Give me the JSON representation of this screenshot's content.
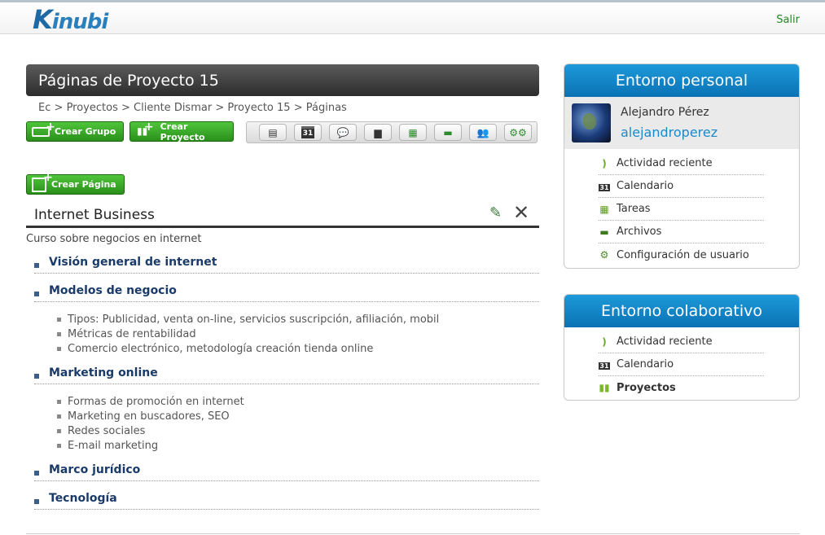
{
  "header": {
    "logo_text": "Kinubi",
    "logout_label": "Salir"
  },
  "main": {
    "title": "Páginas de Proyecto 15",
    "breadcrumb": [
      "Ec",
      "Proyectos",
      "Cliente Dismar",
      "Proyecto 15",
      "Páginas"
    ],
    "breadcrumb_separator": ">",
    "buttons": {
      "create_group": "Crear Grupo",
      "create_project": "Crear Proyecto",
      "create_page": "Crear Página"
    },
    "toolbar_icons": [
      "page-icon",
      "calendar-icon",
      "comments-icon",
      "document-icon",
      "tasks-icon",
      "folder-icon",
      "members-icon",
      "settings-icon"
    ],
    "calendar_day": "31",
    "page": {
      "title": "Internet Business",
      "description": "Curso sobre negocios en internet",
      "sections": [
        {
          "title": "Visión general de internet",
          "items": []
        },
        {
          "title": "Modelos de negocio",
          "items": [
            "Tipos: Publicidad, venta on-line, servicios suscripción, afiliación, mobil",
            "Métricas de rentabilidad",
            "Comercio electrónico, metodología creación tienda online"
          ]
        },
        {
          "title": "Marketing online",
          "items": [
            "Formas de promoción en internet",
            "Marketing en buscadores, SEO",
            "Redes sociales",
            "E-mail marketing"
          ]
        },
        {
          "title": "Marco jurídico",
          "items": []
        },
        {
          "title": "Tecnología",
          "items": []
        }
      ]
    }
  },
  "sidebar": {
    "personal": {
      "title": "Entorno personal",
      "user_name": "Alejandro Pérez",
      "user_login": "alejandroperez",
      "items": [
        "Actividad reciente",
        "Calendario",
        "Tareas",
        "Archivos",
        "Configuración de usuario"
      ]
    },
    "collab": {
      "title": "Entorno colaborativo",
      "items": [
        "Actividad reciente",
        "Calendario",
        "Proyectos"
      ],
      "active_item": "Proyectos"
    }
  }
}
